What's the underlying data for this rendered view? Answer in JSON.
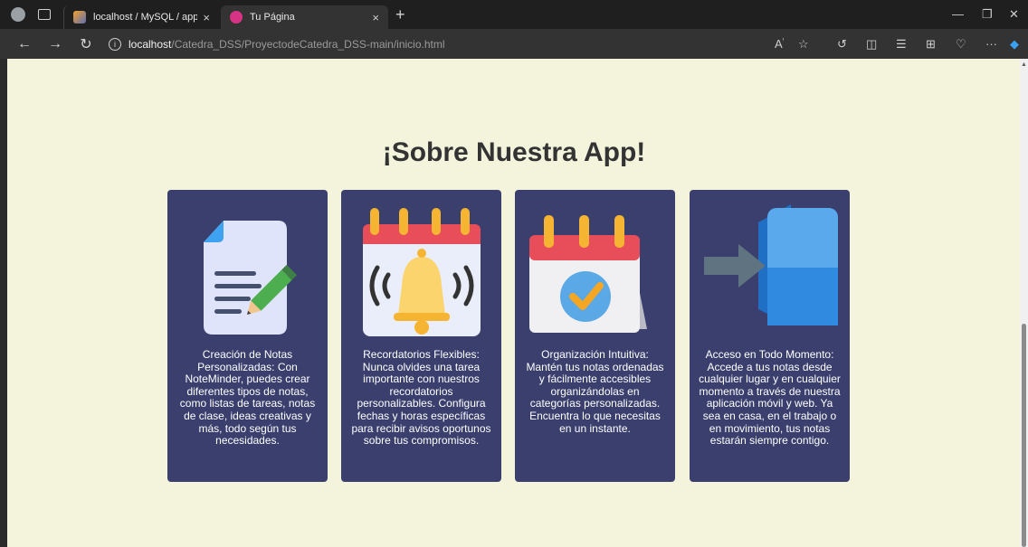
{
  "browser": {
    "tabs": [
      {
        "title": "localhost / MySQL / app_notas /",
        "close": "×"
      },
      {
        "title": "Tu Página",
        "close": "×"
      }
    ],
    "new_tab": "+",
    "url_host": "localhost",
    "url_path": "/Catedra_DSS/ProyectodeCatedra_DSS-main/inicio.html"
  },
  "page": {
    "heading": "¡Sobre Nuestra App!",
    "cards": [
      {
        "icon": "document-pencil-icon",
        "text": "Creación de Notas Personalizadas: Con NoteMinder, puedes crear diferentes tipos de notas, como listas de tareas, notas de clase, ideas creativas y más, todo según tus necesidades."
      },
      {
        "icon": "calendar-bell-icon",
        "text": "Recordatorios Flexibles: Nunca olvides una tarea importante con nuestros recordatorios personalizables. Configura fechas y horas específicas para recibir avisos oportunos sobre tus compromisos."
      },
      {
        "icon": "calendar-check-icon",
        "text": "Organización Intuitiva: Mantén tus notas ordenadas y fácilmente accesibles organizándolas en categorías personalizadas. Encuentra lo que necesitas en un instante."
      },
      {
        "icon": "door-arrow-icon",
        "text": "Acceso en Todo Momento: Accede a tus notas desde cualquier lugar y en cualquier momento a través de nuestra aplicación móvil y web. Ya sea en casa, en el trabajo o en movimiento, tus notas estarán siempre contigo."
      }
    ]
  },
  "colors": {
    "page_bg": "#f4f4dd",
    "card_bg": "#3a3f6d",
    "heading": "#333333"
  }
}
